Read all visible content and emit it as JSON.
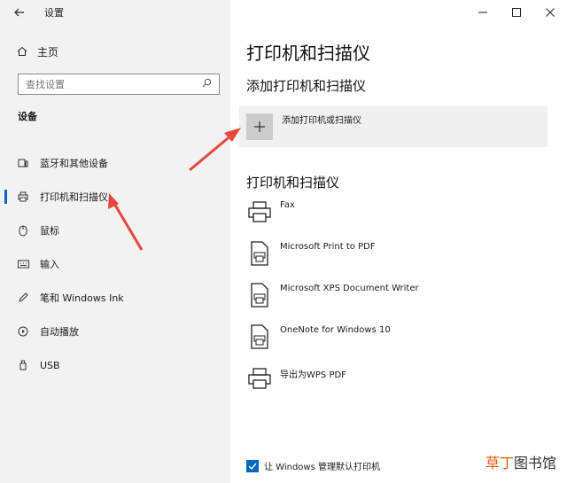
{
  "app": {
    "title": "设置"
  },
  "sidebar": {
    "home_label": "主页",
    "search_placeholder": "查找设置",
    "section_title": "设备",
    "items": [
      {
        "label": "蓝牙和其他设备",
        "icon": "bluetooth-devices-icon"
      },
      {
        "label": "打印机和扫描仪",
        "icon": "printer-icon",
        "active": true
      },
      {
        "label": "鼠标",
        "icon": "mouse-icon"
      },
      {
        "label": "输入",
        "icon": "keyboard-icon"
      },
      {
        "label": "笔和 Windows Ink",
        "icon": "pen-icon"
      },
      {
        "label": "自动播放",
        "icon": "autoplay-icon"
      },
      {
        "label": "USB",
        "icon": "usb-icon"
      }
    ]
  },
  "main": {
    "title": "打印机和扫描仪",
    "add_section_title": "添加打印机和扫描仪",
    "add_button_label": "添加打印机或扫描仪",
    "list_title": "打印机和扫描仪",
    "printers": [
      {
        "name": "Fax",
        "icon": "fax-printer-icon"
      },
      {
        "name": "Microsoft Print to PDF",
        "icon": "pdf-printer-icon"
      },
      {
        "name": "Microsoft XPS Document Writer",
        "icon": "xps-printer-icon"
      },
      {
        "name": "OneNote for Windows 10",
        "icon": "onenote-printer-icon"
      },
      {
        "name": "导出为WPS PDF",
        "icon": "printer-icon"
      }
    ],
    "manage_default_label": "让 Windows 管理默认打印机",
    "manage_default_checked": true
  },
  "watermark": {
    "part1": "草丁",
    "part2": "图书馆"
  },
  "colors": {
    "accent": "#0067c0",
    "annotation_arrow": "#e8453c",
    "sidebar_bg": "#f2f2f2"
  }
}
